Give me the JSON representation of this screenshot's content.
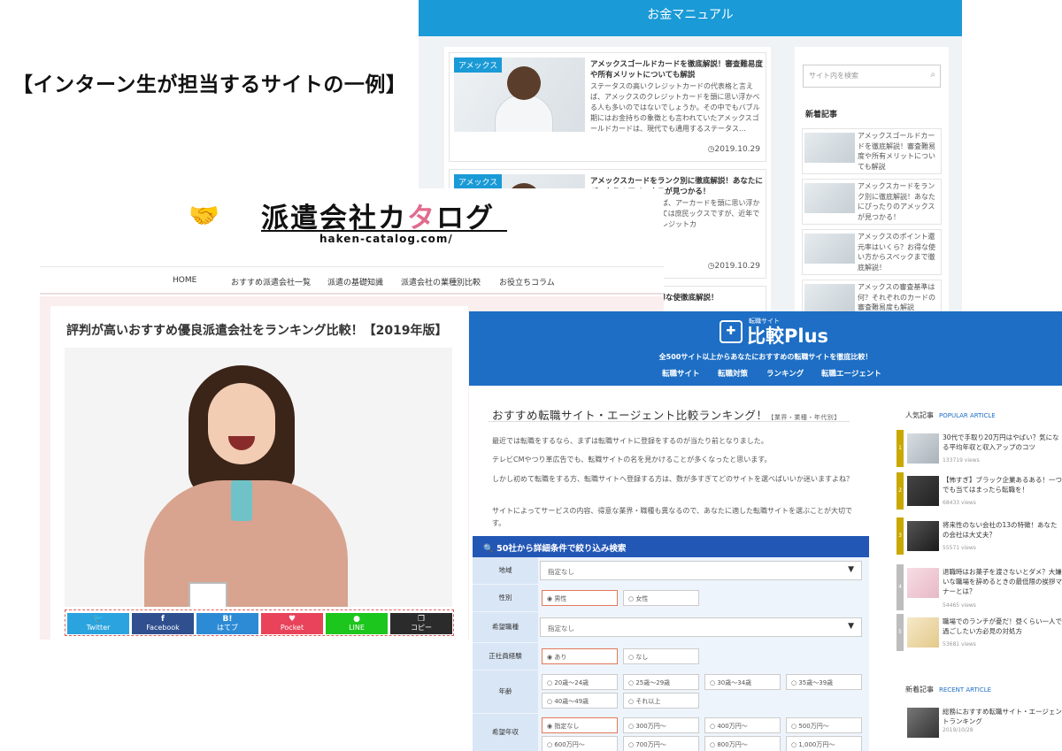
{
  "caption": "【インターン生が担当するサイトの一例】",
  "site_money": {
    "header_title": "お金マニュアル",
    "articles": [
      {
        "category": "アメックス",
        "title": "アメックスゴールドカードを徹底解説！審査難易度や所有メリットについても解説",
        "excerpt": "ステータスの高いクレジットカードの代表格と言えば、アメックスのクレジットカードを頭に思い浮かべる人も多いのではないでしょうか。その中でもバブル期にはお金持ちの象徴とも言われていたアメックスゴールドカードは、現代でも通用するステータス…",
        "date": "2019.10.29"
      },
      {
        "category": "アメックス",
        "title": "アメックスカードをランク別に徹底解説！あなたにぴったりのアメックスが見つかる！",
        "excerpt": "レジットカードと言えば、アーカードを頭に思い浮かべるでしょうか。かつては庶民ックスですが、近年では審手に入れやすいクレジットカ",
        "date": "2019.10.29"
      }
    ],
    "partial_third_title": "還元率はいくら？お得な使徹底解説！",
    "search_placeholder": "サイト内を検索",
    "new_articles_heading": "新着記事",
    "side_articles": [
      "アメックスゴールドカードを徹底解説！審査難易度や所有メリットについても解説",
      "アメックスカードをランク別に徹底解説！あなたにぴったりのアメックスが見つかる！",
      "アメックスのポイント還元率はいくら？お得な使い方からスペックまで徹底解説！",
      "アメックスの審査基準は何？それぞれのカードの審査難易度も解説"
    ]
  },
  "site_haken": {
    "logo_text_a": "派遣会社カ",
    "logo_text_pink": "タ",
    "logo_text_b": "ログ",
    "logo_url": "haken-catalog.com/",
    "nav": [
      "HOME",
      "おすすめ派遣会社一覧",
      "派遣の基礎知識",
      "派遣会社の業種別比較",
      "お役立ちコラム"
    ],
    "article_title": "評判が高いおすすめ優良派遣会社をランキング比較！【2019年版】",
    "share_buttons": [
      {
        "icon": "🐦",
        "label": "Twitter"
      },
      {
        "icon": "f",
        "label": "Facebook"
      },
      {
        "icon": "B!",
        "label": "はてブ"
      },
      {
        "icon": "♥",
        "label": "Pocket"
      },
      {
        "icon": "●",
        "label": "LINE"
      },
      {
        "icon": "❐",
        "label": "コピー"
      }
    ]
  },
  "site_tenshoku": {
    "logo_small": "転職サイト",
    "logo_big": "比較Plus",
    "tagline": "全500サイト以上からあなたにおすすめの転職サイトを徹底比較！",
    "nav": [
      "転職サイト",
      "転職対策",
      "ランキング",
      "転職エージェント"
    ],
    "heading": "おすすめ転職サイト・エージェント比較ランキング！",
    "heading_sub": "【業界・業種・年代別】",
    "paragraphs": [
      "最近では転職をするなら、まずは転職サイトに登録をするのが当たり前となりました。",
      "テレビCMやつり革広告でも、転職サイトの名を見かけることが多くなったと思います。",
      "しかし初めて転職をする方、転職サイトへ登録する方は、数が多すぎてどのサイトを選べばいいか迷いますよね？",
      "サイトによってサービスの内容、得意な業界・職種も異なるので、あなたに適した転職サイトを選ぶことが大切です。"
    ],
    "search_title": "50社から詳細条件で絞り込み検索",
    "form": {
      "area_label": "地域",
      "area_value": "指定なし",
      "gender_label": "性別",
      "gender_options": [
        "男性",
        "女性"
      ],
      "job_label": "希望職種",
      "job_value": "指定なし",
      "regular_label": "正社員経験",
      "regular_options": [
        "あり",
        "なし"
      ],
      "age_label": "年齢",
      "age_options": [
        "20歳〜24歳",
        "25歳〜29歳",
        "30歳〜34歳",
        "35歳〜39歳",
        "40歳〜49歳",
        "それ以上"
      ],
      "income_label": "希望年収",
      "income_options": [
        "指定なし",
        "300万円〜",
        "400万円〜",
        "500万円〜",
        "600万円〜",
        "700万円〜",
        "800万円〜",
        "1,000万円〜"
      ]
    },
    "popular_heading": "人気記事",
    "popular_heading_en": "POPULAR ARTICLE",
    "popular": [
      {
        "num": "1",
        "title": "30代で手取り20万円はやばい？気になる平均年収と収入アップのコツ",
        "views": "133719 views"
      },
      {
        "num": "2",
        "title": "【怖すぎ】ブラック企業あるある！一つでも当てはまったら転職を！",
        "views": "68433 views"
      },
      {
        "num": "3",
        "title": "将来性のない会社の13の特徴！あなたの会社は大丈夫？",
        "views": "55571 views"
      },
      {
        "num": "4",
        "title": "退職時はお菓子を渡さないとダメ？大嫌いな職場を辞めるときの最低限の挨拶マナーとは？",
        "views": "54465 views"
      },
      {
        "num": "5",
        "title": "職場でのランチが憂だ！昼くらい一人で過ごしたい方必見の対処方",
        "views": "53681 views"
      }
    ],
    "recent_heading": "新着記事",
    "recent_heading_en": "RECENT ARTICLE",
    "recent": [
      {
        "title": "総務におすすめ転職サイト・エージェントランキング",
        "date": "2019/10/28"
      }
    ],
    "colors": {
      "header": "#1d6ec4",
      "rank1": "#c9a800",
      "rank2": "#c9a800",
      "rank3": "#c9a800",
      "rank4": "#bdbdbd",
      "rank5": "#bdbdbd"
    }
  }
}
